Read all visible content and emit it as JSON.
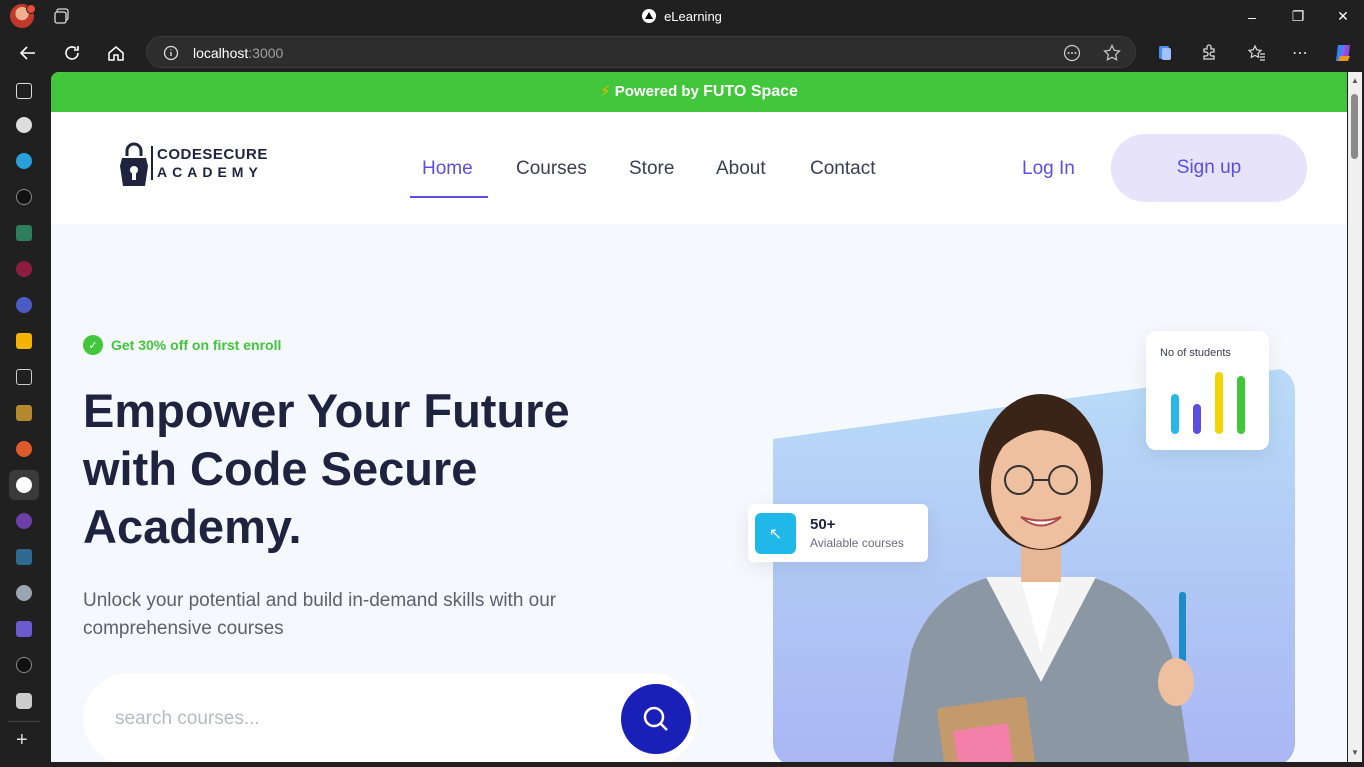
{
  "browser": {
    "window_title": "eLearning",
    "address_host": "localhost",
    "address_port": ":3000"
  },
  "promo": {
    "text": "Powered by ",
    "brand": "FUTO Space"
  },
  "header": {
    "logo_line1": "CODESECURE",
    "logo_line2": "ACADEMY",
    "menu": [
      "Home",
      "Courses",
      "Store",
      "About",
      "Contact"
    ],
    "login_label": "Log In",
    "signup_label": "Sign up"
  },
  "hero": {
    "badge": "Get 30% off on first enroll",
    "title": "Empower Your Future with Code Secure Academy.",
    "subtitle": "Unlock your potential and build in-demand skills with our comprehensive courses",
    "search_placeholder": "search courses..."
  },
  "stats": {
    "courses_count": "50+",
    "courses_label": "Avialable courses",
    "students_label": "No of students"
  },
  "colors": {
    "promo_bg": "#42c63b",
    "accent": "#5b4fe0",
    "search_button": "#1a1fb8"
  }
}
